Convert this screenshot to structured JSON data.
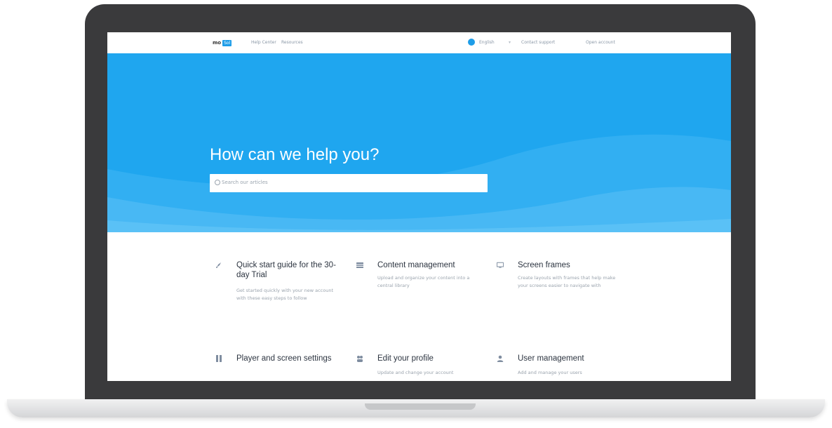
{
  "nav": {
    "logo": "mo",
    "logo_badge": "Sol",
    "link_1": "Help Center",
    "link_2": "Resources",
    "language": "English",
    "contact": "Contact support",
    "account": "Open account"
  },
  "hero": {
    "title": "How can we help you?",
    "search_placeholder": "Search our articles"
  },
  "cards": [
    {
      "icon": "rocket-icon",
      "title": "Quick start guide for the 30-day Trial",
      "desc": "Get started quickly with your new account with these easy steps to follow"
    },
    {
      "icon": "grid-icon",
      "title": "Content management",
      "desc": "Upload and organize your content into a central library"
    },
    {
      "icon": "monitor-icon",
      "title": "Screen frames",
      "desc": "Create layouts with frames that help make your screens easier to navigate with"
    },
    {
      "icon": "columns-icon",
      "title": "Player and screen settings",
      "desc": ""
    },
    {
      "icon": "people-icon",
      "title": "Edit your profile",
      "desc": "Update and change your account"
    },
    {
      "icon": "user-icon",
      "title": "User management",
      "desc": "Add and manage your users"
    }
  ],
  "colors": {
    "hero": "#1fa6ef",
    "accent": "#1e9de8"
  }
}
